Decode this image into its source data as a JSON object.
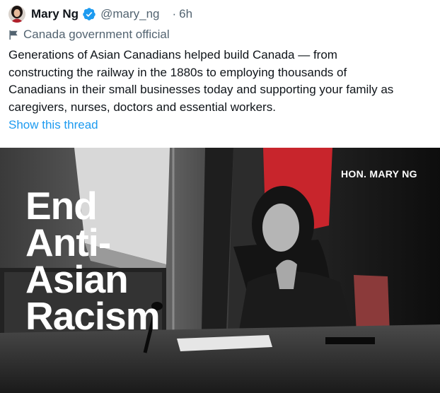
{
  "author": {
    "name": "Mary Ng",
    "handle": "@mary_ng",
    "time_separator": "·",
    "time": "6h",
    "avatar_icon": "avatar-photo",
    "verified_icon": "verified-badge-icon",
    "verified_color": "#1d9bf0"
  },
  "label": {
    "icon": "flag-icon",
    "text": "Canada government official"
  },
  "tweet": {
    "lines": [
      "Generations of Asian Canadians helped build Canada — from",
      "constructing the railway in the 1880s to employing thousands of",
      "Canadians in their small businesses today and supporting your family as",
      "caregivers, nurses, doctors and essential workers."
    ],
    "show_thread": "Show this thread"
  },
  "media": {
    "caption": "HON. MARY NG",
    "headline": [
      "End",
      "Anti-",
      "Asian",
      "Racism"
    ]
  },
  "colors": {
    "text": "#0f1419",
    "secondary": "#536471",
    "link": "#1d9bf0",
    "flag_red": "#c8252c"
  }
}
